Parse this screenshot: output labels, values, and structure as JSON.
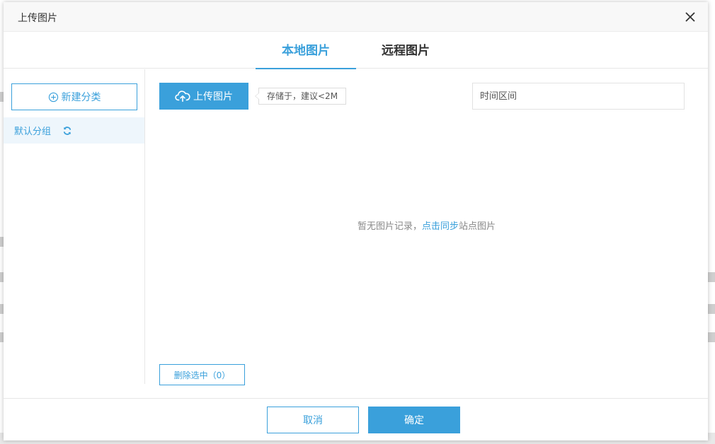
{
  "dialog": {
    "title": "上传图片"
  },
  "tabs": [
    {
      "label": "本地图片",
      "active": true
    },
    {
      "label": "远程图片",
      "active": false
    }
  ],
  "sidebar": {
    "new_category_label": "新建分类",
    "groups": [
      {
        "label": "默认分组",
        "selected": true
      }
    ]
  },
  "toolbar": {
    "upload_label": "上传图片",
    "tip": "存储于，建议<2M",
    "date_range_placeholder": "时间区间"
  },
  "empty_state": {
    "prefix": "暂无图片记录，",
    "link": "点击同步",
    "suffix": "站点图片"
  },
  "delete_selected_label": "删除选中（0）",
  "footer": {
    "cancel_label": "取消",
    "ok_label": "确定"
  },
  "colors": {
    "accent": "#3aa0db",
    "header_bg": "#f8f8f8",
    "selected_group_bg": "#eef6fc"
  },
  "icons": {
    "close": "close-icon",
    "add_circle": "plus-circle-icon",
    "refresh": "refresh-icon",
    "upload": "cloud-upload-icon"
  }
}
